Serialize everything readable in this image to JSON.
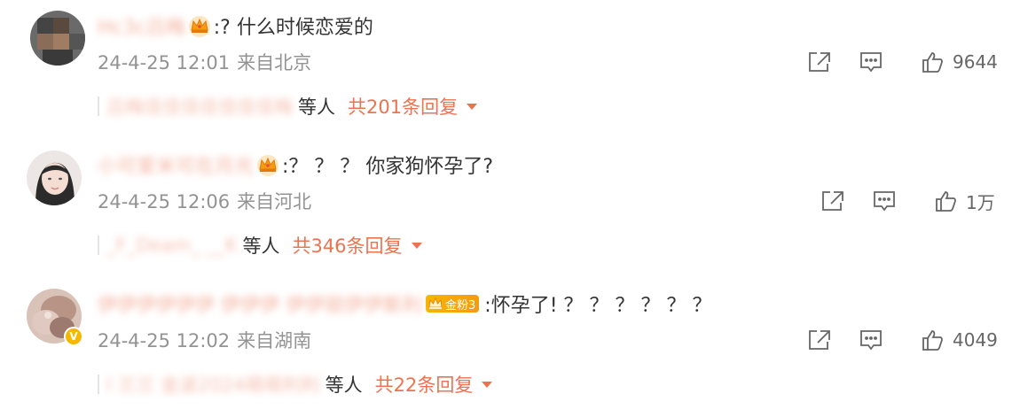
{
  "comments": [
    {
      "username": "Hc3c吕梅",
      "text": ":? 什么时候恋爱的",
      "date": "24-4-25 12:01",
      "location": "来自北京",
      "likes": "9644",
      "reply_names": "吕梅佳佳佳佳佳佳佳梅",
      "reply_etc": "等人",
      "reply_total": "共201条回复"
    },
    {
      "username": "小可爱米可在月光",
      "text": ":？ ？ ？ 你家狗怀孕了?",
      "date": "24-4-25 12:06",
      "location": "来自河北",
      "likes": "1万",
      "reply_names": "_F_Deam_ __K",
      "reply_etc": "等人",
      "reply_total": "共346条回复"
    },
    {
      "username": "伊伊伊伊伊伊 伊伊伊 伊伊丽伊伊斯利",
      "fans_badge": "金粉3",
      "text": ":怀孕了! ？ ？ ？ ？ ？ ？",
      "date": "24-4-25 12:02",
      "location": "来自湖南",
      "likes": "4049",
      "reply_names": "l 兰兰 金波2024萌萌利利",
      "reply_etc": "等人",
      "reply_total": "共22条回复"
    }
  ],
  "icons": {
    "share": "share-icon",
    "comment": "comment-icon",
    "like": "thumbs-up-icon",
    "crown": "crown-icon",
    "verified": "verified-v-icon"
  },
  "colors": {
    "accent": "#eb7350",
    "meta": "#939393",
    "text": "#333333",
    "gold": "#f5b700"
  },
  "verified_mark": "V"
}
